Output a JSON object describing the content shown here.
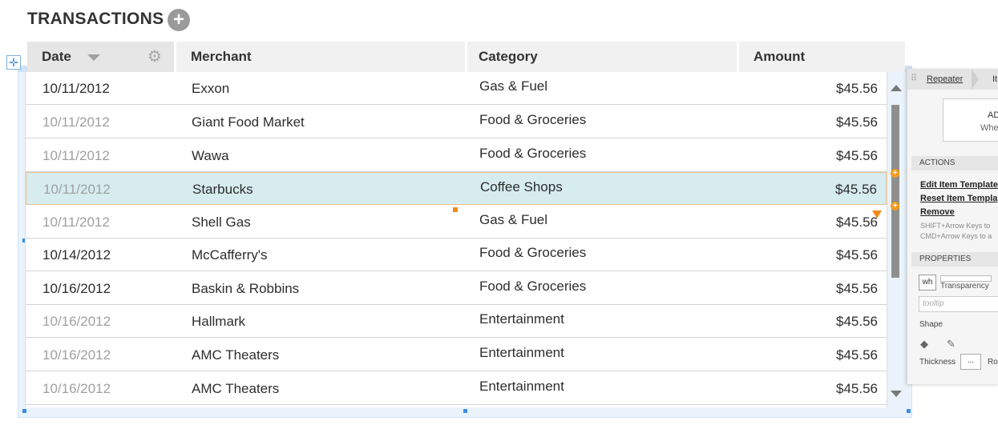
{
  "header": {
    "title": "TRANSACTIONS",
    "add_symbol": "+"
  },
  "columns": {
    "date": "Date",
    "merchant": "Merchant",
    "category": "Category",
    "amount": "Amount"
  },
  "rows": [
    {
      "date": "10/11/2012",
      "merchant": "Exxon",
      "category": "Gas & Fuel",
      "amount": "$45.56",
      "muted": false,
      "selected": false
    },
    {
      "date": "10/11/2012",
      "merchant": "Giant Food Market",
      "category": "Food & Groceries",
      "amount": "$45.56",
      "muted": true,
      "selected": false
    },
    {
      "date": "10/11/2012",
      "merchant": "Wawa",
      "category": "Food & Groceries",
      "amount": "$45.56",
      "muted": true,
      "selected": false
    },
    {
      "date": "10/11/2012",
      "merchant": "Starbucks",
      "category": "Coffee Shops",
      "amount": "$45.56",
      "muted": true,
      "selected": true
    },
    {
      "date": "10/11/2012",
      "merchant": "Shell Gas",
      "category": "Gas & Fuel",
      "amount": "$45.56",
      "muted": true,
      "selected": false
    },
    {
      "date": "10/14/2012",
      "merchant": "McCafferry's",
      "category": "Food & Groceries",
      "amount": "$45.56",
      "muted": false,
      "selected": false
    },
    {
      "date": "10/16/2012",
      "merchant": "Baskin & Robbins",
      "category": "Food & Groceries",
      "amount": "$45.56",
      "muted": false,
      "selected": false
    },
    {
      "date": "10/16/2012",
      "merchant": "Hallmark",
      "category": "Entertainment",
      "amount": "$45.56",
      "muted": true,
      "selected": false
    },
    {
      "date": "10/16/2012",
      "merchant": "AMC Theaters",
      "category": "Entertainment",
      "amount": "$45.56",
      "muted": true,
      "selected": false
    },
    {
      "date": "10/16/2012",
      "merchant": "AMC Theaters",
      "category": "Entertainment",
      "amount": "$45.56",
      "muted": true,
      "selected": false
    }
  ],
  "panel": {
    "tab_repeater": "Repeater",
    "tab_item": "It",
    "add_item_line1": "ADD I",
    "add_item_line2": "Whe",
    "actions_title": "ACTIONS",
    "edit_item_template": "Edit Item Template",
    "reset_item_template": "Reset Item Templa",
    "remove": "Remove",
    "hint1": "SHIFT+Arrow Keys to",
    "hint2": "CMD+Arrow Keys to a",
    "properties_title": "PROPERTIES",
    "w_icon_label": "wh",
    "transparency": "Transparency",
    "tooltip_placeholder": "tooltip",
    "shape": "Shape",
    "thickness": "Thickness",
    "thickness_btn": "...",
    "round": "Ro"
  },
  "colors": {
    "selected_row": "#d6ecef",
    "accent_orange": "#f08a1a",
    "selection_blue": "#3a8ee6"
  },
  "icons": [
    "add-circle-icon",
    "sort-down-icon",
    "gear-icon",
    "move-icon",
    "scroll-up-icon",
    "scroll-down-icon",
    "fill-icon",
    "pen-icon"
  ]
}
